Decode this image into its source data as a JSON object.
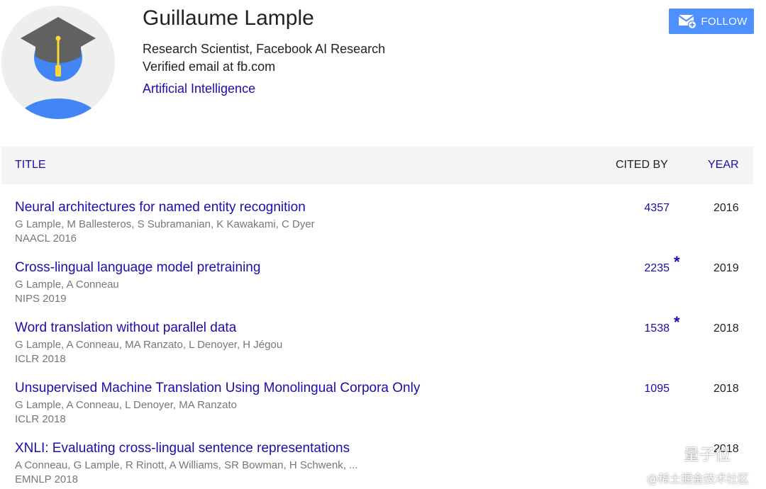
{
  "profile": {
    "name": "Guillaume Lample",
    "affiliation": "Research Scientist, Facebook AI Research",
    "email": "Verified email at fb.com",
    "interest": "Artificial Intelligence",
    "avatar_icon": "graduate-avatar-icon"
  },
  "follow": {
    "label": "FOLLOW",
    "icon": "mail-plus-icon",
    "color": "#4d90fe"
  },
  "table": {
    "headers": {
      "title": "TITLE",
      "cited_by": "CITED BY",
      "year": "YEAR"
    },
    "rows": [
      {
        "title": "Neural architectures for named entity recognition",
        "authors": "G Lample, M Ballesteros, S Subramanian, K Kawakami, C Dyer",
        "venue": "NAACL 2016",
        "cited_by": "4357",
        "star": "",
        "year": "2016"
      },
      {
        "title": "Cross-lingual language model pretraining",
        "authors": "G Lample, A Conneau",
        "venue": "NIPS 2019",
        "cited_by": "2235",
        "star": "*",
        "year": "2019"
      },
      {
        "title": "Word translation without parallel data",
        "authors": "G Lample, A Conneau, MA Ranzato, L Denoyer, H Jégou",
        "venue": "ICLR 2018",
        "cited_by": "1538",
        "star": "*",
        "year": "2018"
      },
      {
        "title": "Unsupervised Machine Translation Using Monolingual Corpora Only",
        "authors": "G Lample, A Conneau, L Denoyer, MA Ranzato",
        "venue": "ICLR 2018",
        "cited_by": "1095",
        "star": "",
        "year": "2018"
      },
      {
        "title": "XNLI: Evaluating cross-lingual sentence representations",
        "authors": "A Conneau, G Lample, R Rinott, A Williams, SR Bowman, H Schwenk, ...",
        "venue": "EMNLP 2018",
        "cited_by": "",
        "star": "",
        "year": "2018"
      }
    ]
  },
  "watermark": {
    "brand": "量子位",
    "subtitle": "@稀土掘金技术社区",
    "icon": "wechat-icon"
  },
  "colors": {
    "link": "#1a0dab",
    "meta_text": "#777777",
    "header_bg": "#f5f5f5",
    "avatar_bg": "#eeeeee",
    "avatar_person": "#4285f4",
    "mortarboard": "#616161",
    "tassel": "#fdd835"
  }
}
